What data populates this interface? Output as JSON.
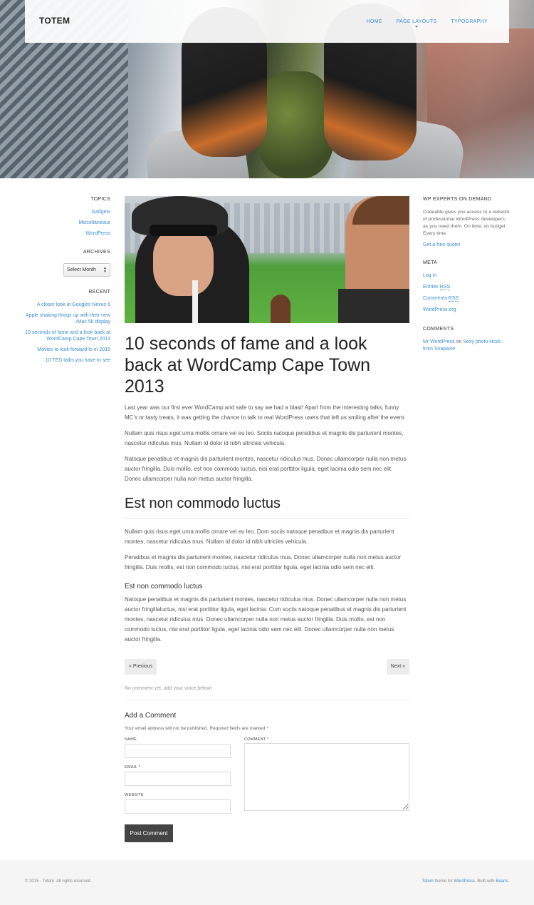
{
  "header": {
    "logo": "TOTEM",
    "nav": [
      "HOME",
      "PAGE LAYOUTS",
      "TYPOGRAPHY"
    ]
  },
  "left_sidebar": {
    "topics_title": "TOPICS",
    "topics": [
      "Gadgets",
      "Miscellaneous",
      "WordPress"
    ],
    "archives_title": "ARCHIVES",
    "archives_select": "Select Month",
    "recent_title": "RECENT",
    "recent": [
      "A closer look at Googles Nexus 6",
      "Apple shaking things up with their new iMac 5k display",
      "10 seconds of fame and a look back at WordCamp Cape Town 2013",
      "Movies to look forward to in 2015",
      "10 TED talks you have to see"
    ]
  },
  "post": {
    "title": "10 seconds of fame and a look back at WordCamp Cape Town 2013",
    "para1": "Last year was our first ever WordCamp and safe to say we had a blast! Apart from the interesting talks, funny MC’s or tasty treats, it was getting the chance to talk to real WordPress users that left us smiling after the event.",
    "para2": "Nullam quis risus eget urna mollis ornare vel eu leo. Sociis natoque penatibus et magnis dis parturient montes, nascetur ridiculus mus. Nullam id dolor id nibh ultricies vehicula.",
    "para3": "Natoque penatibus et magnis dis parturient montes, nascetur ridiculus mus. Donec ullamcorper nulla non metus auctor fringilla. Duis mollis, est non commodo luctus, nisi erat porttitor ligula, eget lacinia odio sem nec elit. Donec ullamcorper nulla non metus auctor fringilla.",
    "heading2": "Est non commodo luctus",
    "para4": "Nullam quis risus eget urna mollis ornare vel eu leo. Dom sociis natoque penatibus et magnis dis parturient montes, nascetur ridiculus mus. Nullam id dolor id nibh ultricies vehicula.",
    "para5": "Penatibus et magnis dis parturient montes, nascetur ridiculus mus. Donec ullamcorper nulla non metus auctor fringilla. Duis mollis, est non commodo luctus, nisi erat porttitor ligula, eget lacinia odio sem nec elit.",
    "heading3": "Est non commodo luctus",
    "para6": "Natoque penatibus et magnis dis parturient montes, nascetur ridiculus mus. Donec ullamcorper nulla non metus auctor fringillaluctus, nisi erat porttitor ligula, eget lacinia. Cum sociis natoque penatibus et magnis dis parturient montes, nascetur ridiculus mus. Donec ullamcorper nulla non metus auctor fringilla. Duis mollis, est non commodo luctus, nisi erat porttitor ligula, eget lacinia odio sem nec elit. Donec ullamcorper nulla non metus auctor fringilla."
  },
  "pager": {
    "prev": "« Previous",
    "next": "Next »"
  },
  "comments": {
    "none_text": "No comment yet, add your voice below!",
    "title": "Add a Comment",
    "note": "Your email address will not be published. Required fields are marked *",
    "name_label": "NAME",
    "email_label": "EMAIL *",
    "website_label": "WEBSITE",
    "comment_label": "COMMENT *",
    "submit": "Post Comment"
  },
  "right_sidebar": {
    "experts_title": "WP EXPERTS ON DEMAND",
    "experts_text": "Codeable gives you access to a network of professional WordPress developers, as you need them. On time, on budget. Every time.",
    "experts_link": "Get a free quote!",
    "meta_title": "META",
    "meta_login": "Log in",
    "meta_entries": "Entries",
    "meta_comments": "Comments",
    "meta_rss": "RSS",
    "meta_wp": "WordPress.org",
    "comments_title": "COMMENTS",
    "comment_author": "Mr WordPress",
    "comment_on": "on",
    "comment_post": "Sexy photo stock from Snapwire"
  },
  "footer": {
    "copyright": "© 2015 - Totem. All rights reserved.",
    "theme_name": "Totem",
    "theme_text": "theme for",
    "wp": "WordPress",
    "built": ". Built-with",
    "beans": "Beans",
    "end": "."
  }
}
